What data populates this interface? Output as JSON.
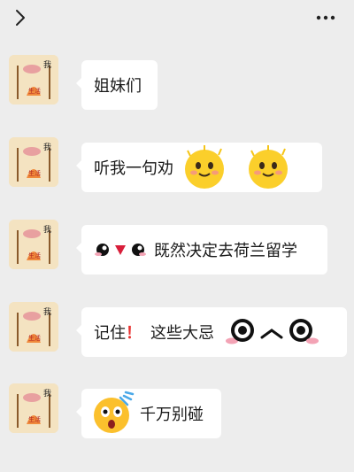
{
  "nav": {
    "back_icon": "chevron-left-icon",
    "more_icon": "more-dots-icon"
  },
  "avatar": {
    "label_top": "我",
    "label_bottom": "生活"
  },
  "messages": [
    {
      "parts": [
        "姐妹们"
      ]
    },
    {
      "parts": [
        "听我一句劝"
      ],
      "emoji": [
        "smiling-blob-emoji",
        "smiling-blob-emoji"
      ]
    },
    {
      "emoji_lead": "shy-face-emoji",
      "parts": [
        "既然决定去荷兰留学"
      ]
    },
    {
      "parts": [
        "记住",
        "！",
        "这些大忌"
      ],
      "emoji": [
        "wide-eyes-face-emoji"
      ]
    },
    {
      "emoji_lead": "shocked-face-emoji",
      "parts": [
        "千万别碰"
      ]
    }
  ],
  "colors": {
    "background": "#ededed",
    "bubble": "#ffffff",
    "exclaim": "#e8312f"
  }
}
